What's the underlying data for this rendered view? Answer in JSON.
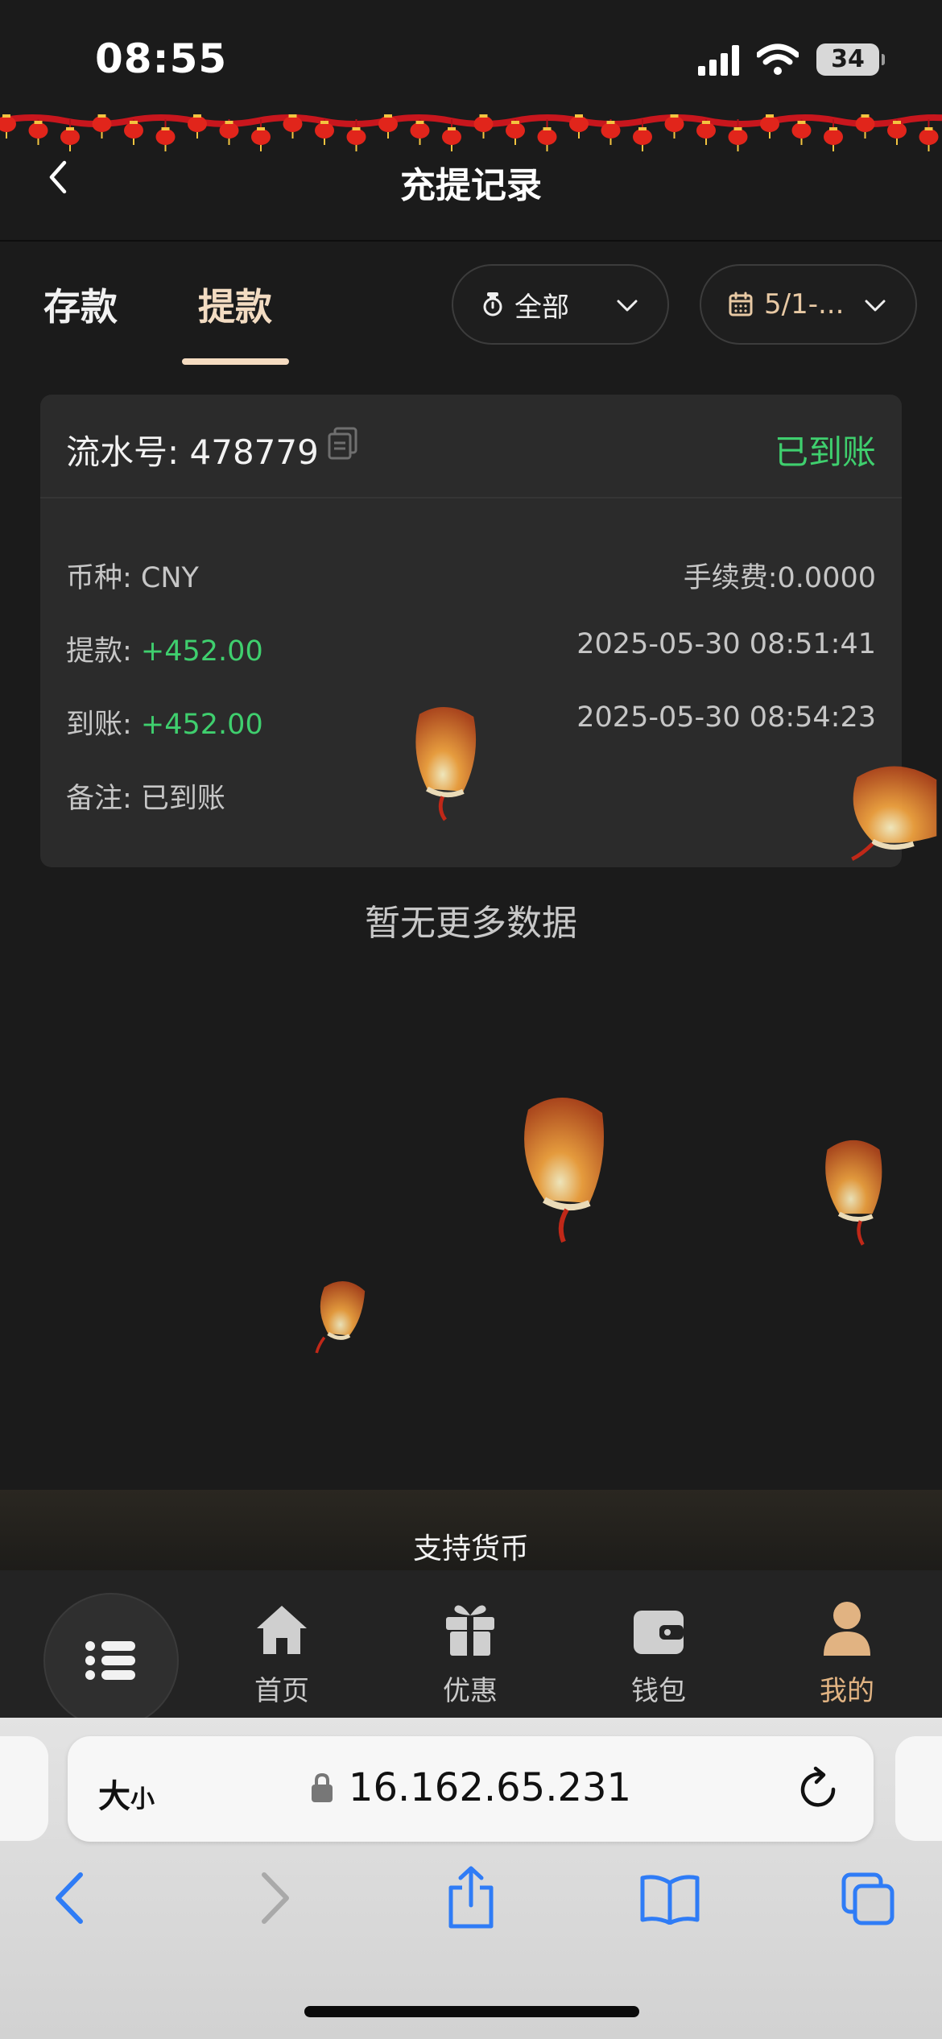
{
  "status_bar": {
    "time": "08:55",
    "battery": "34"
  },
  "header": {
    "title": "充提记录"
  },
  "tabs": [
    {
      "label": "存款",
      "active": false
    },
    {
      "label": "提款",
      "active": true
    }
  ],
  "filters": {
    "status": "全部",
    "date": "5/1-..."
  },
  "record": {
    "serial": "流水号: 478779",
    "status": "已到账",
    "currency": "币种: CNY",
    "fee": "手续费:0.0000",
    "withdraw_label": "提款: ",
    "withdraw_amount": "+452.00",
    "withdraw_time": "2025-05-30 08:51:41",
    "arrival_label": "到账: ",
    "arrival_amount": "+452.00",
    "arrival_time": "2025-05-30 08:54:23",
    "remark": "备注: 已到账"
  },
  "empty_text": "暂无更多数据",
  "currency_banner": "支持货币",
  "bottom_nav": [
    {
      "label": "首页",
      "icon": "home-icon"
    },
    {
      "label": "优惠",
      "icon": "gift-icon"
    },
    {
      "label": "钱包",
      "icon": "wallet-icon"
    },
    {
      "label": "我的",
      "icon": "user-icon",
      "active": true
    }
  ],
  "browser": {
    "text_size_big": "大",
    "text_size_small": "小",
    "url": "16.162.65.231"
  },
  "colors": {
    "accent_gold": "#f5dcc1",
    "success_green": "#3fcf6e",
    "background": "#1b1b1b"
  }
}
